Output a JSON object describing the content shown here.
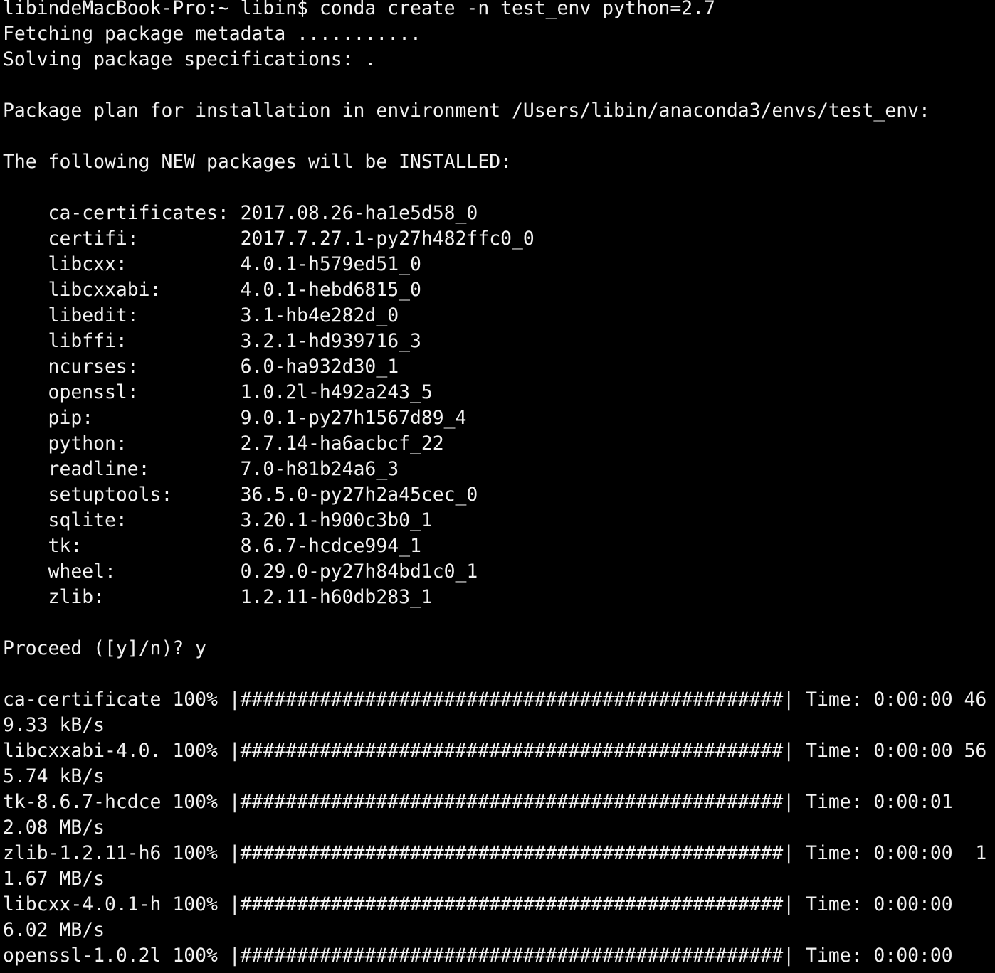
{
  "terminal": {
    "background": "#000000",
    "foreground": "#f2f2f2",
    "lines": [
      "libindeMacBook-Pro:~ libin$ conda create -n test_env python=2.7",
      "Fetching package metadata ...........",
      "Solving package specifications: .",
      "",
      "Package plan for installation in environment /Users/libin/anaconda3/envs/test_env:",
      "",
      "The following NEW packages will be INSTALLED:",
      "",
      "    ca-certificates: 2017.08.26-ha1e5d58_0",
      "    certifi:         2017.7.27.1-py27h482ffc0_0",
      "    libcxx:          4.0.1-h579ed51_0",
      "    libcxxabi:       4.0.1-hebd6815_0",
      "    libedit:         3.1-hb4e282d_0",
      "    libffi:          3.2.1-hd939716_3",
      "    ncurses:         6.0-ha932d30_1",
      "    openssl:         1.0.2l-h492a243_5",
      "    pip:             9.0.1-py27h1567d89_4",
      "    python:          2.7.14-ha6acbcf_22",
      "    readline:        7.0-h81b24a6_3",
      "    setuptools:      36.5.0-py27h2a45cec_0",
      "    sqlite:          3.20.1-h900c3b0_1",
      "    tk:              8.6.7-hcdce994_1",
      "    wheel:           0.29.0-py27h84bd1c0_1",
      "    zlib:            1.2.11-h60db283_1",
      "",
      "Proceed ([y]/n)? y",
      "",
      "ca-certificate 100% |################################################| Time: 0:00:00 46",
      "9.33 kB/s",
      "libcxxabi-4.0. 100% |################################################| Time: 0:00:00 56",
      "5.74 kB/s",
      "tk-8.6.7-hcdce 100% |################################################| Time: 0:00:01",
      "2.08 MB/s",
      "zlib-1.2.11-h6 100% |################################################| Time: 0:00:00  1",
      "1.67 MB/s",
      "libcxx-4.0.1-h 100% |################################################| Time: 0:00:00",
      "6.02 MB/s",
      "openssl-1.0.2l 100% |################################################| Time: 0:00:00"
    ]
  }
}
